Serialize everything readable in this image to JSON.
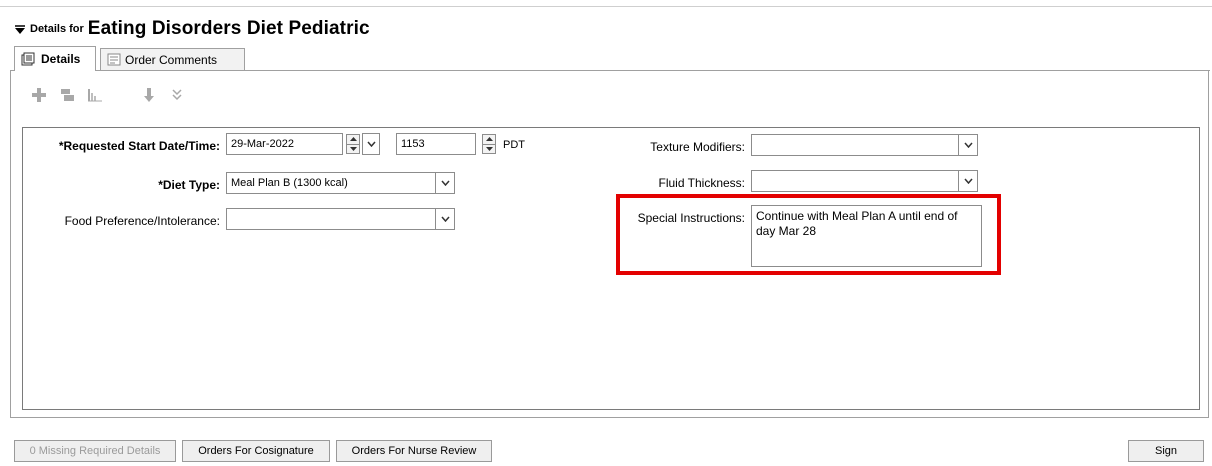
{
  "header": {
    "prefix": "Details for",
    "order_name": "Eating Disorders Diet Pediatric"
  },
  "tabs": [
    {
      "label": "Details",
      "icon": "details-icon",
      "active": true
    },
    {
      "label": "Order Comments",
      "icon": "comments-icon",
      "active": false
    }
  ],
  "toolbar": {
    "buttons": [
      "add-icon",
      "remove-icon",
      "chart-icon",
      "move-down-icon",
      "expand-all-icon"
    ]
  },
  "form": {
    "start": {
      "label": "*Requested Start Date/Time:",
      "date": "29-Mar-2022",
      "time": "1153",
      "timezone": "PDT"
    },
    "diet_type": {
      "label": "*Diet Type:",
      "value": "Meal Plan B (1300 kcal)"
    },
    "food_pref": {
      "label": "Food Preference/Intolerance:",
      "value": ""
    },
    "texture": {
      "label": "Texture Modifiers:",
      "value": ""
    },
    "fluid": {
      "label": "Fluid Thickness:",
      "value": ""
    },
    "special": {
      "label": "Special Instructions:",
      "value": "Continue with Meal Plan A until end of day Mar 28"
    }
  },
  "footer": {
    "missing": "0 Missing Required Details",
    "cosign": "Orders For Cosignature",
    "nurse": "Orders For Nurse Review",
    "sign": "Sign"
  },
  "colors": {
    "highlight": "#e30000",
    "border": "#a0a0a0"
  }
}
